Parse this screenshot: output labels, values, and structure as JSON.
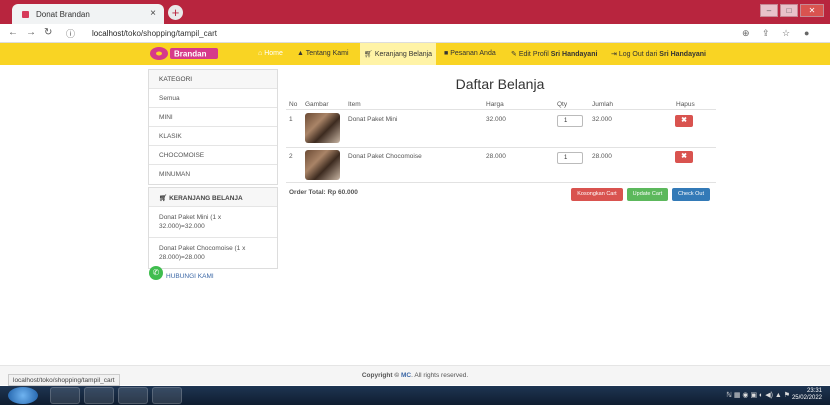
{
  "browser": {
    "tab_title": "Donat Brandan",
    "tab_close": "×",
    "new_tab": "+",
    "url_host": "localhost",
    "url_path": "/toko/shopping/tampil_cart",
    "status_url": "localhost/toko/shopping/tampil_cart"
  },
  "colors": {
    "titlebar": "#b8253e",
    "nav": "#f9d423",
    "danger": "#d9534f",
    "success": "#5cb85c",
    "primary": "#337ab7"
  },
  "nav": {
    "logo": "Brandan",
    "home": "Home",
    "about": "Tentang Kami",
    "cart": "Keranjang Belanja",
    "orders": "Pesanan Anda",
    "edit_profile_prefix": "Edit Profil",
    "edit_profile_name": "Sri Handayani",
    "logout_prefix": "Log Out dari",
    "logout_name": "Sri Handayani"
  },
  "sidebar": {
    "category_title": "KATEGORI",
    "categories": [
      "Semua",
      "MINI",
      "KLASIK",
      "CHOCOMOISE",
      "MINUMAN"
    ],
    "cart_title": "KERANJANG BELANJA",
    "cart_items": [
      "Donat Paket Mini (1 x 32.000)=32.000",
      "Donat Paket Chocomoise (1 x 28.000)=28.000"
    ],
    "contact": "HUBUNGI KAMI"
  },
  "main": {
    "title": "Daftar Belanja",
    "columns": [
      "No",
      "Gambar",
      "Item",
      "Harga",
      "Qty",
      "Jumlah",
      "Hapus"
    ],
    "rows": [
      {
        "no": "1",
        "item": "Donat Paket Mini",
        "price": "32.000",
        "qty": "1",
        "total": "32.000"
      },
      {
        "no": "2",
        "item": "Donat Paket Chocomoise",
        "price": "28.000",
        "qty": "1",
        "total": "28.000"
      }
    ],
    "delete_symbol": "✖",
    "order_total": "Order Total: Rp 60.000",
    "buttons": {
      "clear": "Kosongkan Cart",
      "update": "Update Cart",
      "checkout": "Check Out"
    }
  },
  "footer": {
    "prefix": "Copyright ©",
    "owner": "MC",
    "suffix": ". All rights reserved."
  },
  "taskbar": {
    "time": "23:31",
    "date": "25/02/2022"
  }
}
